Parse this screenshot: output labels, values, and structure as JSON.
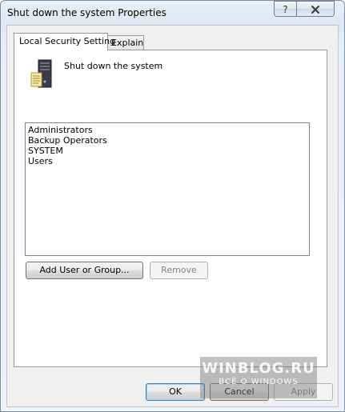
{
  "window": {
    "title": "Shut down the system Properties",
    "help_glyph": "?",
    "close_icon": "close-icon"
  },
  "tabs": [
    {
      "label": "Local Security Setting",
      "active": true
    },
    {
      "label": "Explain",
      "active": false
    }
  ],
  "policy": {
    "name": "Shut down the system",
    "icon": "computer-policy-icon"
  },
  "users": [
    "Administrators",
    "Backup Operators",
    "SYSTEM",
    "Users"
  ],
  "buttons": {
    "add": "Add User or Group...",
    "remove": "Remove",
    "ok": "OK",
    "cancel": "Cancel",
    "apply": "Apply"
  },
  "watermark": {
    "main": "WINBLOG.RU",
    "sub": "ВСЁ О WINDOWS"
  }
}
